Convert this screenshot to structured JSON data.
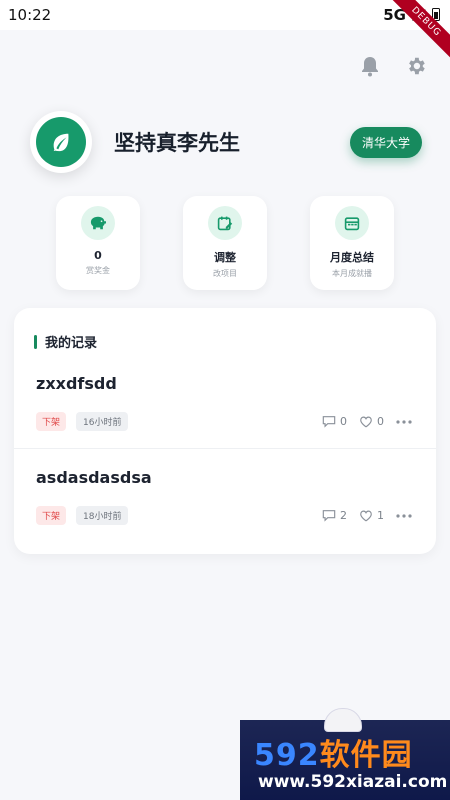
{
  "status_bar": {
    "time": "10:22",
    "network": "5G",
    "debug_label": "DEBUG"
  },
  "header": {
    "icons": [
      "bell-icon",
      "gear-icon"
    ]
  },
  "profile": {
    "name": "坚持真李先生",
    "school": "清华大学",
    "avatar_icon": "leaf-icon"
  },
  "stats": [
    {
      "icon": "piggy-bank-icon",
      "value": "0",
      "label": "赏奖金"
    },
    {
      "icon": "calendar-edit-icon",
      "value": "调整",
      "label": "改项目"
    },
    {
      "icon": "calendar-icon",
      "value": "月度总结",
      "label": "本月成就播"
    }
  ],
  "records": {
    "title": "我的记录",
    "items": [
      {
        "title": "zxxdfsdd",
        "status": "下架",
        "time": "16小时前",
        "comments": "0",
        "likes": "0"
      },
      {
        "title": "asdasdasdsa",
        "status": "下架",
        "time": "18小时前",
        "comments": "2",
        "likes": "1"
      }
    ]
  },
  "watermark": {
    "logo_num": "592",
    "logo_text": "软件园",
    "url": "www.592xiazai.com"
  },
  "colors": {
    "accent": "#178a5e",
    "tag_red": "#e04848",
    "background": "#f6f7fa"
  }
}
